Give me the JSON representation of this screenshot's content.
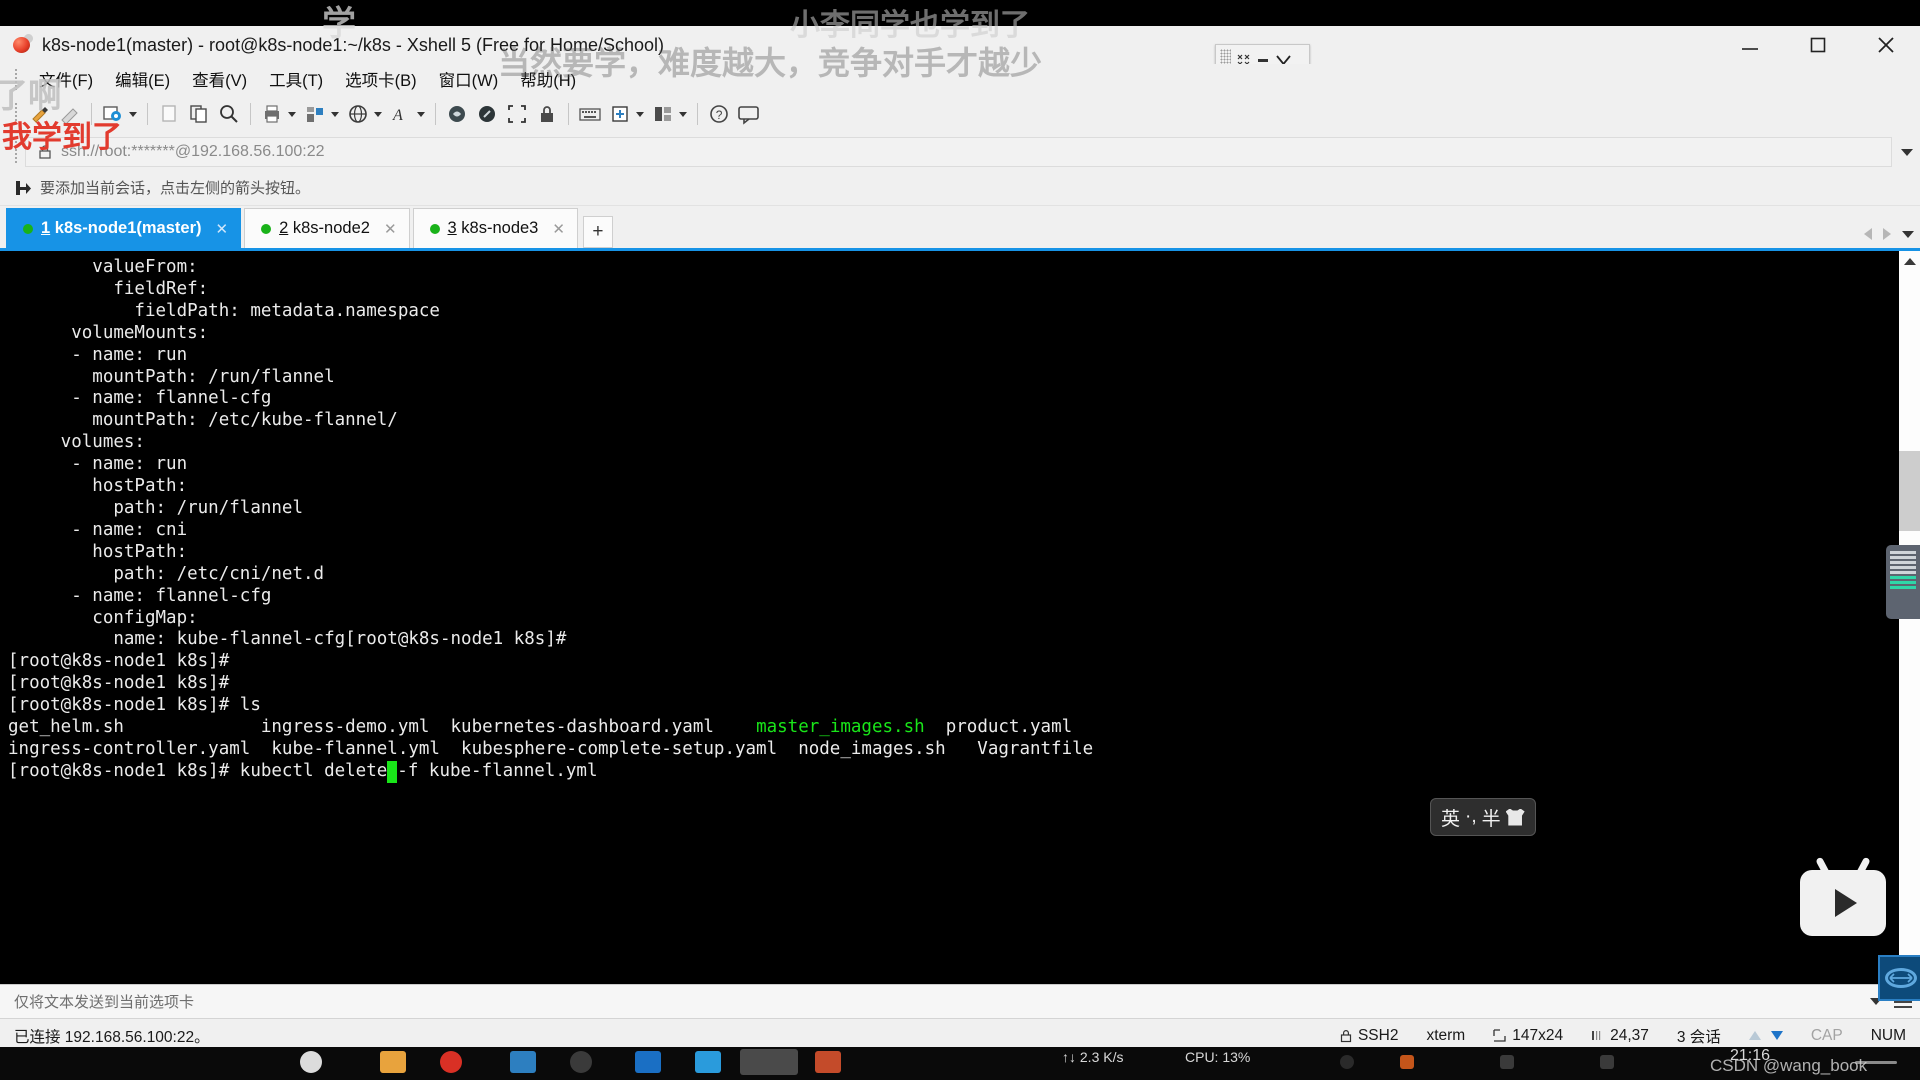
{
  "window": {
    "title": "k8s-node1(master) - root@k8s-node1:~/k8s - Xshell 5 (Free for Home/School)",
    "app_icon": "xshell-icon",
    "controls": {
      "minimize": "minimize-icon",
      "maximize": "maximize-icon",
      "close": "close-icon"
    },
    "float_dock": {
      "grip": "drag-grip-icon",
      "collapse": "collapse-icon",
      "minimize": "minimize-dash-icon",
      "chevron": "chevron-down-icon"
    }
  },
  "menubar": {
    "items": [
      {
        "label": "文件(F)",
        "name": "menu-file"
      },
      {
        "label": "编辑(E)",
        "name": "menu-edit"
      },
      {
        "label": "查看(V)",
        "name": "menu-view"
      },
      {
        "label": "工具(T)",
        "name": "menu-tools"
      },
      {
        "label": "选项卡(B)",
        "name": "menu-tabs"
      },
      {
        "label": "窗口(W)",
        "name": "menu-window"
      },
      {
        "label": "帮助(H)",
        "name": "menu-help"
      }
    ]
  },
  "toolbar": {
    "buttons": [
      {
        "icon": "new-session-icon"
      },
      {
        "icon": "open-session-icon"
      },
      {
        "icon": "properties-gear-icon",
        "caret": true
      },
      {
        "icon": "blank-page-icon"
      },
      {
        "icon": "copy-icon"
      },
      {
        "icon": "find-icon"
      },
      {
        "icon": "print-icon",
        "caret": true
      },
      {
        "icon": "transfer-files-icon",
        "caret": true
      },
      {
        "icon": "globe-icon",
        "caret": true
      },
      {
        "icon": "font-icon",
        "caret": true
      },
      {
        "icon": "log-icon"
      },
      {
        "icon": "compose-icon"
      },
      {
        "icon": "fullscreen-icon"
      },
      {
        "icon": "lock-icon"
      },
      {
        "icon": "keyboard-icon"
      },
      {
        "icon": "add-panel-icon",
        "caret": true
      },
      {
        "icon": "layout-icon",
        "caret": true
      },
      {
        "icon": "help-icon"
      },
      {
        "icon": "chat-icon"
      }
    ]
  },
  "address": {
    "lock_icon": "lock-icon",
    "value": "ssh://root:*******@192.168.56.100:22",
    "dropdown_icon": "chevron-down-icon"
  },
  "hint": {
    "icon": "add-session-arrow-icon",
    "text": "要添加当前会话，点击左侧的箭头按钮。"
  },
  "tabs": {
    "items": [
      {
        "num": "1",
        "label": "k8s-node1(master)",
        "active": true,
        "status": "connected"
      },
      {
        "num": "2",
        "label": "k8s-node2",
        "active": false,
        "status": "connected"
      },
      {
        "num": "3",
        "label": "k8s-node3",
        "active": false,
        "status": "connected"
      }
    ],
    "add_label": "+",
    "scroll_left_icon": "arrow-left-icon",
    "scroll_right_icon": "arrow-right-icon",
    "tab_list_icon": "chevron-down-icon"
  },
  "terminal": {
    "lines": [
      "        valueFrom:",
      "          fieldRef:",
      "            fieldPath: metadata.namespace",
      "      volumeMounts:",
      "      - name: run",
      "        mountPath: /run/flannel",
      "      - name: flannel-cfg",
      "        mountPath: /etc/kube-flannel/",
      "     volumes:",
      "      - name: run",
      "        hostPath:",
      "          path: /run/flannel",
      "      - name: cni",
      "        hostPath:",
      "          path: /etc/cni/net.d",
      "      - name: flannel-cfg",
      "        configMap:",
      "          name: kube-flannel-cfg[root@k8s-node1 k8s]#",
      "[root@k8s-node1 k8s]#",
      "[root@k8s-node1 k8s]#",
      "[root@k8s-node1 k8s]# ls"
    ],
    "ls_row1": {
      "plain_a": "get_helm.sh             ingress-demo.yml  kubernetes-dashboard.yaml    ",
      "green": "master_images.sh",
      "plain_b": "  product.yaml"
    },
    "ls_row2": "ingress-controller.yaml  kube-flannel.yml  kubesphere-complete-setup.yaml  node_images.sh   Vagrantfile",
    "prompt": "[root@k8s-node1 k8s]# kubectl delete",
    "cursor_char": " ",
    "command_tail": "-f kube-flannel.yml",
    "scrollbar": {
      "up_icon": "chevron-up-icon"
    }
  },
  "sendbar": {
    "placeholder": "仅将文本发送到当前选项卡",
    "dropdown_icon": "chevron-down-icon",
    "menu_icon": "hamburger-icon"
  },
  "statusbar": {
    "connection": "已连接 192.168.56.100:22。",
    "protocol_icon": "lock-icon",
    "protocol": "SSH2",
    "terminal_type": "xterm",
    "size_icon": "terminal-size-icon",
    "size": "147x24",
    "cursor_icon": "cursor-pos-icon",
    "cursor_pos": "24,37",
    "sessions": "3 会话",
    "upload_icon": "arrow-up-icon",
    "download_icon": "arrow-down-icon",
    "cap": "CAP",
    "num": "NUM"
  },
  "overlays": {
    "watermark_top": "小李同学也学到了",
    "watermark_mid": "当然要学，难度越大，竞争对手才越少",
    "watermark_left_a": "学",
    "watermark_left_b": "了啊",
    "watermark_red": "我学到了",
    "csdn": "CSDN @wang_book"
  },
  "ime": {
    "lang": "英",
    "punct": "·,",
    "width_mode": "半",
    "skin_icon": "shirt-icon"
  },
  "taskbar": {
    "network": "↑↓ 2.3 K/s",
    "cpu": "CPU: 13%",
    "clock": "21:16"
  },
  "colors": {
    "accent": "#1793e6",
    "terminal_bg": "#000000",
    "terminal_fg": "#ebebeb",
    "terminal_green": "#19e619",
    "tab_status_dot": "#19b219",
    "window_chrome": "#f0f0f0"
  }
}
